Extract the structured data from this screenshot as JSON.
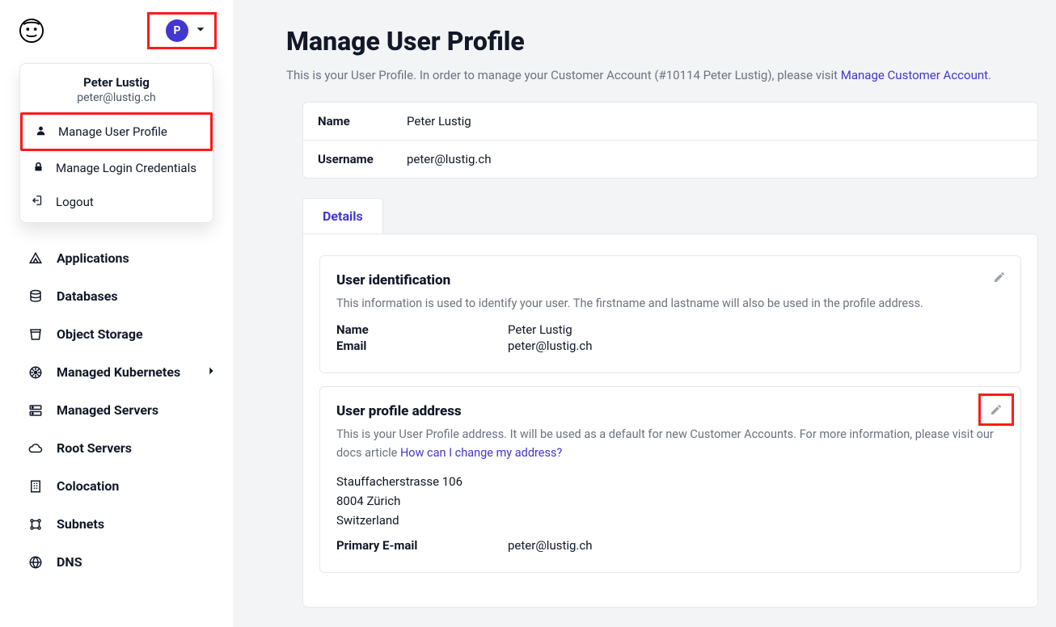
{
  "header": {
    "avatar_initial": "P"
  },
  "dropdown": {
    "name": "Peter Lustig",
    "email": "peter@lustig.ch",
    "items": [
      {
        "label": "Manage User Profile"
      },
      {
        "label": "Manage Login Credentials"
      },
      {
        "label": "Logout"
      }
    ]
  },
  "sidebar": {
    "items": [
      {
        "label": "Applications"
      },
      {
        "label": "Databases"
      },
      {
        "label": "Object Storage"
      },
      {
        "label": "Managed Kubernetes",
        "has_sub": true
      },
      {
        "label": "Managed Servers"
      },
      {
        "label": "Root Servers"
      },
      {
        "label": "Colocation"
      },
      {
        "label": "Subnets"
      },
      {
        "label": "DNS"
      }
    ]
  },
  "page": {
    "title": "Manage User Profile",
    "subtitle_prefix": "This is your User Profile. In order to manage your Customer Account (#10114 Peter Lustig), please visit ",
    "subtitle_link": "Manage Customer Account",
    "subtitle_suffix": "."
  },
  "summary": {
    "name_label": "Name",
    "name_value": "Peter Lustig",
    "username_label": "Username",
    "username_value": "peter@lustig.ch"
  },
  "tabs": {
    "details": "Details"
  },
  "ident": {
    "heading": "User identification",
    "desc": "This information is used to identify your user. The firstname and lastname will also be used in the profile address.",
    "name_label": "Name",
    "name_value": "Peter Lustig",
    "email_label": "Email",
    "email_value": "peter@lustig.ch"
  },
  "address": {
    "heading": "User profile address",
    "desc_prefix": "This is your User Profile address. It will be used as a default for new Customer Accounts. For more information, please visit our docs article ",
    "desc_link": "How can I change my address?",
    "line1": "Stauffacherstrasse 106",
    "line2": "8004 Zürich",
    "line3": "Switzerland",
    "primary_email_label": "Primary E-mail",
    "primary_email_value": "peter@lustig.ch"
  }
}
